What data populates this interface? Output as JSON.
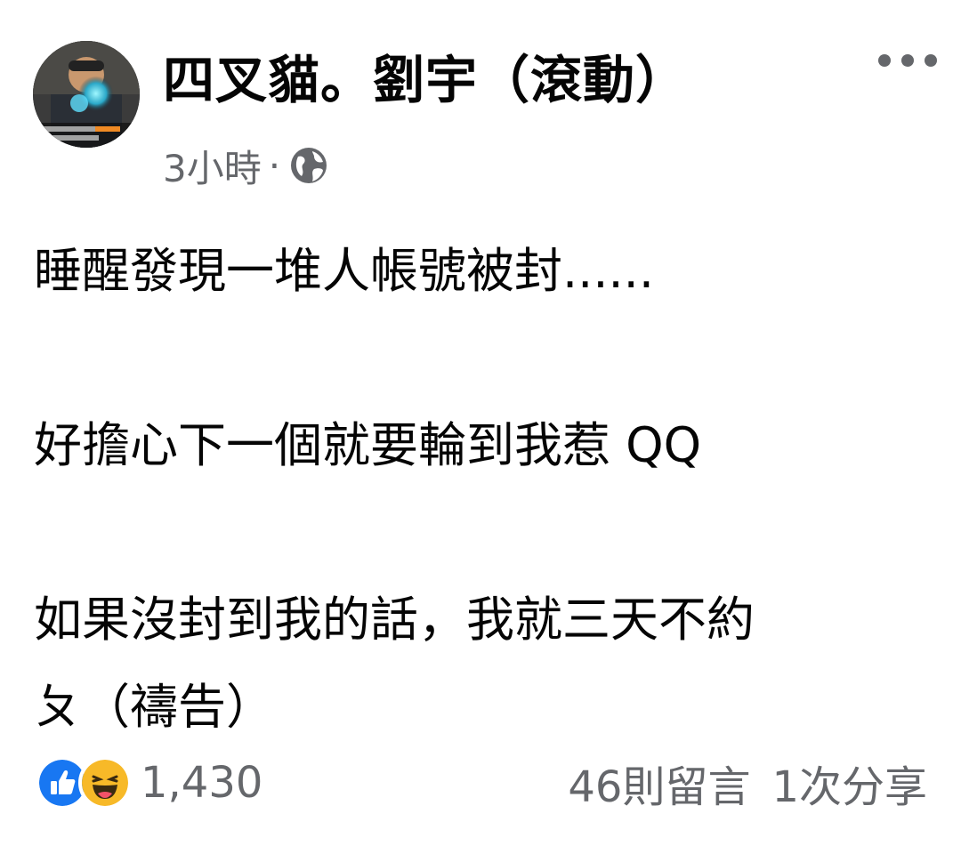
{
  "post": {
    "author_name": "四叉貓。劉宇（滾動）",
    "timestamp": "3小時",
    "separator": "·",
    "audience_icon": "globe-icon",
    "more_icon": "more-options-icon",
    "text_paragraphs": [
      "睡醒發現一堆人帳號被封......",
      "好擔心下一個就要輪到我惹 QQ",
      "如果沒封到我的話，我就三天不約",
      "ㄆ（禱告）"
    ]
  },
  "footer": {
    "reaction_icons": [
      "like-reaction-icon",
      "haha-reaction-icon"
    ],
    "reaction_count": "1,430",
    "comments": "46則留言",
    "shares": "1次分享"
  },
  "colors": {
    "text_primary": "#050505",
    "text_secondary": "#65676b",
    "like_blue": "#1877f2",
    "haha_yellow": "#f7b928"
  }
}
